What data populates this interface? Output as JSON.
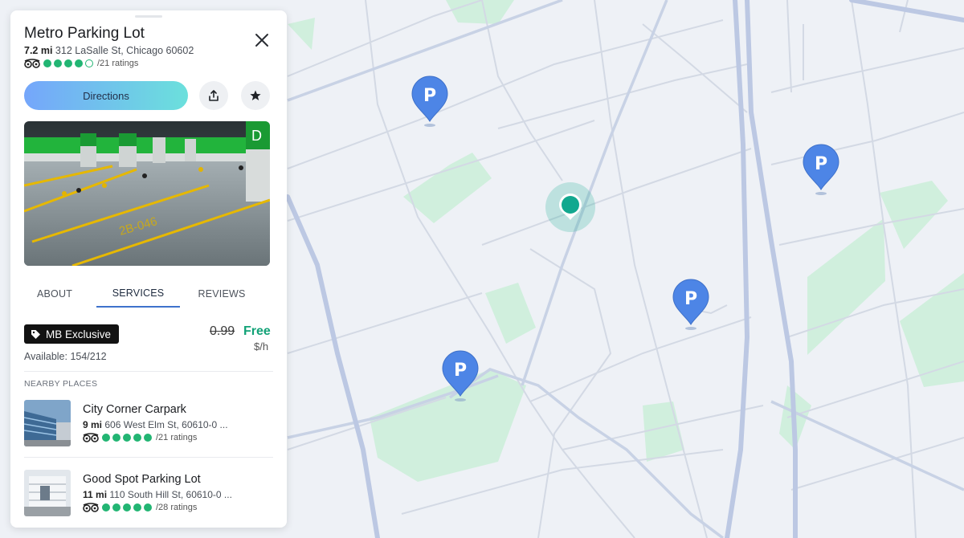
{
  "place": {
    "name": "Metro Parking Lot",
    "distance": "7.2 mi",
    "address": "312 LaSalle St, Chicago 60602",
    "rating": 4,
    "rating_max": 5,
    "ratings_count": "/21 ratings"
  },
  "actions": {
    "directions_label": "Directions",
    "share_icon": "share-icon",
    "favorite_icon": "star-icon",
    "close_icon": "close-icon"
  },
  "tabs": [
    {
      "label": "ABOUT",
      "active": false
    },
    {
      "label": "SERVICES",
      "active": true
    },
    {
      "label": "REVIEWS",
      "active": false
    }
  ],
  "offer": {
    "badge": "MB Exclusive",
    "badge_icon": "tag-icon",
    "old_price": "0.99",
    "new_price": "Free",
    "unit": "$/h",
    "availability": "Available: 154/212"
  },
  "nearby": {
    "heading": "NEARBY PLACES",
    "items": [
      {
        "name": "City Corner Carpark",
        "distance": "9 mi",
        "address": "606 West Elm St, 60610-0 ...",
        "rating": 5,
        "ratings_count": "/21 ratings"
      },
      {
        "name": "Good Spot Parking Lot",
        "distance": "11 mi",
        "address": "110 South Hill St, 60610-0 ...",
        "rating": 5,
        "ratings_count": "/28 ratings"
      }
    ]
  },
  "map": {
    "marker_letter": "P",
    "marker_icon": "parking-pin-icon",
    "location_icon": "current-location-icon",
    "colors": {
      "background": "#eef1f6",
      "park": "#d0efdd",
      "road": "#d3d9e4",
      "highway": "#bcc8e3",
      "pin": "#4d85e6",
      "location": "#12a88f",
      "rating": "#22b573",
      "price_free": "#12a277"
    }
  }
}
